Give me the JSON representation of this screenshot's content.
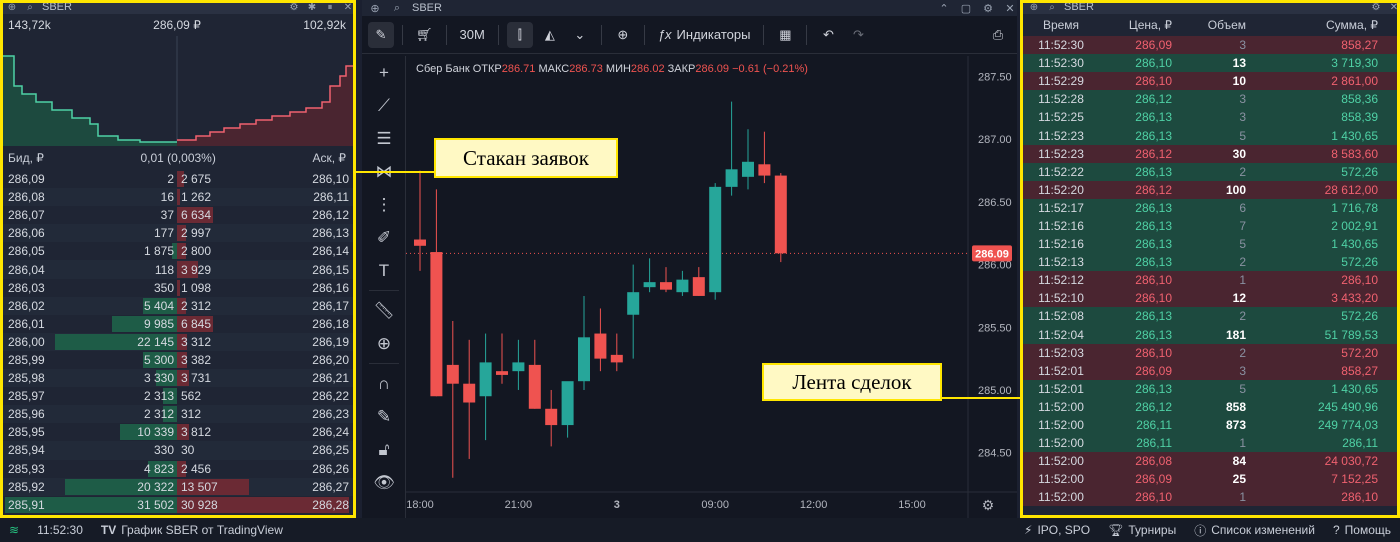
{
  "order_book": {
    "ticker": "SBER",
    "depth_left": "143,72k",
    "depth_mid": "286,09 ₽",
    "depth_right": "102,92k",
    "bid_header": "Бид, ₽",
    "spread": "0,01 (0,003%)",
    "ask_header": "Аск, ₽",
    "rows": [
      {
        "bid_price": "286,09",
        "bid_vol": "2",
        "ask_vol": "2 675",
        "ask_price": "286,10",
        "bid_level": 0.0,
        "ask_level": 0.04
      },
      {
        "bid_price": "286,08",
        "bid_vol": "16",
        "ask_vol": "1 262",
        "ask_price": "286,11",
        "bid_level": 0.0,
        "ask_level": 0.02
      },
      {
        "bid_price": "286,07",
        "bid_vol": "37",
        "ask_vol": "6 634",
        "ask_price": "286,12",
        "bid_level": 0.0,
        "ask_level": 0.21
      },
      {
        "bid_price": "286,06",
        "bid_vol": "177",
        "ask_vol": "2 997",
        "ask_price": "286,13",
        "bid_level": 0.0,
        "ask_level": 0.05
      },
      {
        "bid_price": "286,05",
        "bid_vol": "1 875",
        "ask_vol": "2 800",
        "ask_price": "286,14",
        "bid_level": 0.03,
        "ask_level": 0.05
      },
      {
        "bid_price": "286,04",
        "bid_vol": "118",
        "ask_vol": "3 929",
        "ask_price": "286,15",
        "bid_level": 0.0,
        "ask_level": 0.12
      },
      {
        "bid_price": "286,03",
        "bid_vol": "350",
        "ask_vol": "1 098",
        "ask_price": "286,16",
        "bid_level": 0.0,
        "ask_level": 0.02
      },
      {
        "bid_price": "286,02",
        "bid_vol": "5 404",
        "ask_vol": "2 312",
        "ask_price": "286,17",
        "bid_level": 0.2,
        "ask_level": 0.05
      },
      {
        "bid_price": "286,01",
        "bid_vol": "9 985",
        "ask_vol": "6 845",
        "ask_price": "286,18",
        "bid_level": 0.38,
        "ask_level": 0.21
      },
      {
        "bid_price": "286,00",
        "bid_vol": "22 145",
        "ask_vol": "3 312",
        "ask_price": "286,19",
        "bid_level": 0.71,
        "ask_level": 0.06
      },
      {
        "bid_price": "285,99",
        "bid_vol": "5 300",
        "ask_vol": "3 382",
        "ask_price": "286,20",
        "bid_level": 0.2,
        "ask_level": 0.06
      },
      {
        "bid_price": "285,98",
        "bid_vol": "3 330",
        "ask_vol": "3 731",
        "ask_price": "286,21",
        "bid_level": 0.12,
        "ask_level": 0.07
      },
      {
        "bid_price": "285,97",
        "bid_vol": "2 313",
        "ask_vol": "562",
        "ask_price": "286,22",
        "bid_level": 0.08,
        "ask_level": 0.0
      },
      {
        "bid_price": "285,96",
        "bid_vol": "2 312",
        "ask_vol": "312",
        "ask_price": "286,23",
        "bid_level": 0.08,
        "ask_level": 0.0
      },
      {
        "bid_price": "285,95",
        "bid_vol": "10 339",
        "ask_vol": "3 812",
        "ask_price": "286,24",
        "bid_level": 0.33,
        "ask_level": 0.07
      },
      {
        "bid_price": "285,94",
        "bid_vol": "330",
        "ask_vol": "30",
        "ask_price": "286,25",
        "bid_level": 0.0,
        "ask_level": 0.0
      },
      {
        "bid_price": "285,93",
        "bid_vol": "4 823",
        "ask_vol": "2 456",
        "ask_price": "286,26",
        "bid_level": 0.17,
        "ask_level": 0.05
      },
      {
        "bid_price": "285,92",
        "bid_vol": "20 322",
        "ask_vol": "13 507",
        "ask_price": "286,27",
        "bid_level": 0.65,
        "ask_level": 0.42
      },
      {
        "bid_price": "285,91",
        "bid_vol": "31 502",
        "ask_vol": "30 928",
        "ask_price": "286,28",
        "bid_level": 1.0,
        "ask_level": 1.0
      }
    ]
  },
  "chart": {
    "ticker": "SBER",
    "timeframe": "30M",
    "indicators_label": "Индикаторы",
    "legend": {
      "name": "Сбер Банк",
      "open_label": "ОТКР",
      "open": "286.71",
      "high_label": "МАКС",
      "high": "286.73",
      "low_label": "МИН",
      "low": "286.02",
      "close_label": "ЗАКР",
      "close": "286.09",
      "change": "−0.61 (−0.21%)"
    },
    "current_price": "286.09",
    "colors": {
      "up": "#26a69a",
      "down": "#ef5350",
      "bg": "#131722"
    }
  },
  "chart_data": {
    "type": "candlestick",
    "y_ticks": [
      "287.50",
      "287.00",
      "286.50",
      "286.00",
      "285.50",
      "285.00",
      "284.50"
    ],
    "ylim": [
      284.25,
      287.6
    ],
    "x_ticks": [
      "18:00",
      "21:00",
      "3",
      "09:00",
      "12:00",
      "15:00"
    ],
    "x_tick_index": [
      0,
      6,
      12,
      18,
      24,
      30
    ],
    "last_price": 286.09,
    "candles": [
      {
        "o": 286.2,
        "h": 286.75,
        "l": 285.95,
        "c": 286.15
      },
      {
        "o": 286.1,
        "h": 286.6,
        "l": 284.95,
        "c": 284.95
      },
      {
        "o": 285.2,
        "h": 285.55,
        "l": 284.3,
        "c": 285.05
      },
      {
        "o": 285.05,
        "h": 285.4,
        "l": 284.45,
        "c": 284.9
      },
      {
        "o": 284.95,
        "h": 285.45,
        "l": 284.6,
        "c": 285.22
      },
      {
        "o": 285.15,
        "h": 285.45,
        "l": 285.05,
        "c": 285.12
      },
      {
        "o": 285.15,
        "h": 285.4,
        "l": 285.0,
        "c": 285.22
      },
      {
        "o": 285.2,
        "h": 285.4,
        "l": 284.85,
        "c": 284.85
      },
      {
        "o": 284.85,
        "h": 285.0,
        "l": 284.55,
        "c": 284.72
      },
      {
        "o": 284.72,
        "h": 285.05,
        "l": 284.62,
        "c": 285.07
      },
      {
        "o": 285.07,
        "h": 285.75,
        "l": 285.0,
        "c": 285.42
      },
      {
        "o": 285.45,
        "h": 285.65,
        "l": 285.15,
        "c": 285.25
      },
      {
        "o": 285.28,
        "h": 285.45,
        "l": 285.15,
        "c": 285.22
      },
      {
        "o": 285.6,
        "h": 286.0,
        "l": 285.25,
        "c": 285.78
      },
      {
        "o": 285.82,
        "h": 286.05,
        "l": 285.78,
        "c": 285.86
      },
      {
        "o": 285.86,
        "h": 285.98,
        "l": 285.78,
        "c": 285.8
      },
      {
        "o": 285.78,
        "h": 285.95,
        "l": 285.75,
        "c": 285.88
      },
      {
        "o": 285.9,
        "h": 285.98,
        "l": 285.75,
        "c": 285.75
      },
      {
        "o": 285.78,
        "h": 286.65,
        "l": 285.72,
        "c": 286.62
      },
      {
        "o": 286.62,
        "h": 287.3,
        "l": 286.55,
        "c": 286.76
      },
      {
        "o": 286.7,
        "h": 287.08,
        "l": 286.6,
        "c": 286.82
      },
      {
        "o": 286.8,
        "h": 287.06,
        "l": 286.65,
        "c": 286.71
      },
      {
        "o": 286.71,
        "h": 286.73,
        "l": 286.02,
        "c": 286.09
      }
    ]
  },
  "trades": {
    "ticker": "SBER",
    "headers": {
      "time": "Время",
      "price": "Цена, ₽",
      "volume": "Объем",
      "sum": "Сумма, ₽"
    },
    "rows": [
      {
        "time": "11:52:30",
        "price": "286,09",
        "volume": "3",
        "sum": "858,27",
        "side": "sell",
        "big": false
      },
      {
        "time": "11:52:30",
        "price": "286,10",
        "volume": "13",
        "sum": "3 719,30",
        "side": "buy",
        "big": true
      },
      {
        "time": "11:52:29",
        "price": "286,10",
        "volume": "10",
        "sum": "2 861,00",
        "side": "sell",
        "big": true
      },
      {
        "time": "11:52:28",
        "price": "286,12",
        "volume": "3",
        "sum": "858,36",
        "side": "buy",
        "big": false
      },
      {
        "time": "11:52:25",
        "price": "286,13",
        "volume": "3",
        "sum": "858,39",
        "side": "buy",
        "big": false
      },
      {
        "time": "11:52:23",
        "price": "286,13",
        "volume": "5",
        "sum": "1 430,65",
        "side": "buy",
        "big": false
      },
      {
        "time": "11:52:23",
        "price": "286,12",
        "volume": "30",
        "sum": "8 583,60",
        "side": "sell",
        "big": true
      },
      {
        "time": "11:52:22",
        "price": "286,13",
        "volume": "2",
        "sum": "572,26",
        "side": "buy",
        "big": false
      },
      {
        "time": "11:52:20",
        "price": "286,12",
        "volume": "100",
        "sum": "28 612,00",
        "side": "sell",
        "big": true
      },
      {
        "time": "11:52:17",
        "price": "286,13",
        "volume": "6",
        "sum": "1 716,78",
        "side": "buy",
        "big": false
      },
      {
        "time": "11:52:16",
        "price": "286,13",
        "volume": "7",
        "sum": "2 002,91",
        "side": "buy",
        "big": false
      },
      {
        "time": "11:52:16",
        "price": "286,13",
        "volume": "5",
        "sum": "1 430,65",
        "side": "buy",
        "big": false
      },
      {
        "time": "11:52:13",
        "price": "286,13",
        "volume": "2",
        "sum": "572,26",
        "side": "buy",
        "big": false
      },
      {
        "time": "11:52:12",
        "price": "286,10",
        "volume": "1",
        "sum": "286,10",
        "side": "sell",
        "big": false
      },
      {
        "time": "11:52:10",
        "price": "286,10",
        "volume": "12",
        "sum": "3 433,20",
        "side": "sell",
        "big": true
      },
      {
        "time": "11:52:08",
        "price": "286,13",
        "volume": "2",
        "sum": "572,26",
        "side": "buy",
        "big": false
      },
      {
        "time": "11:52:04",
        "price": "286,13",
        "volume": "181",
        "sum": "51 789,53",
        "side": "buy",
        "big": true
      },
      {
        "time": "11:52:03",
        "price": "286,10",
        "volume": "2",
        "sum": "572,20",
        "side": "sell",
        "big": false
      },
      {
        "time": "11:52:01",
        "price": "286,09",
        "volume": "3",
        "sum": "858,27",
        "side": "sell",
        "big": false
      },
      {
        "time": "11:52:01",
        "price": "286,13",
        "volume": "5",
        "sum": "1 430,65",
        "side": "buy",
        "big": false
      },
      {
        "time": "11:52:00",
        "price": "286,12",
        "volume": "858",
        "sum": "245 490,96",
        "side": "buy",
        "big": true
      },
      {
        "time": "11:52:00",
        "price": "286,11",
        "volume": "873",
        "sum": "249 774,03",
        "side": "buy",
        "big": true
      },
      {
        "time": "11:52:00",
        "price": "286,11",
        "volume": "1",
        "sum": "286,11",
        "side": "buy",
        "big": false
      },
      {
        "time": "11:52:00",
        "price": "286,08",
        "volume": "84",
        "sum": "24 030,72",
        "side": "sell",
        "big": true
      },
      {
        "time": "11:52:00",
        "price": "286,09",
        "volume": "25",
        "sum": "7 152,25",
        "side": "sell",
        "big": true
      },
      {
        "time": "11:52:00",
        "price": "286,10",
        "volume": "1",
        "sum": "286,10",
        "side": "sell",
        "big": false
      }
    ]
  },
  "annotations": {
    "order_book_label": "Стакан заявок",
    "trades_label": "Лента сделок"
  },
  "status_bar": {
    "time": "11:52:30",
    "chart_credit": "График SBER от TradingView",
    "ipo": "IPO, SPO",
    "tournaments": "Турниры",
    "changelog": "Список изменений",
    "help": "Помощь"
  }
}
